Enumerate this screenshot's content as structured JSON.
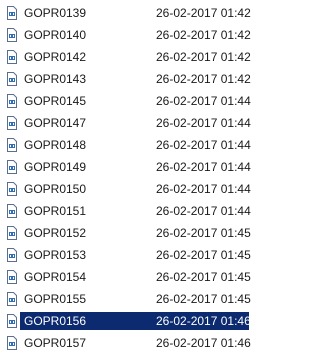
{
  "files": [
    {
      "name": "GOPR0139",
      "modified": "26-02-2017 01:42",
      "icon": "video-file-icon"
    },
    {
      "name": "GOPR0140",
      "modified": "26-02-2017 01:42",
      "icon": "video-file-icon"
    },
    {
      "name": "GOPR0142",
      "modified": "26-02-2017 01:42",
      "icon": "video-file-icon"
    },
    {
      "name": "GOPR0143",
      "modified": "26-02-2017 01:42",
      "icon": "video-file-icon"
    },
    {
      "name": "GOPR0145",
      "modified": "26-02-2017 01:44",
      "icon": "video-file-icon"
    },
    {
      "name": "GOPR0147",
      "modified": "26-02-2017 01:44",
      "icon": "video-file-icon"
    },
    {
      "name": "GOPR0148",
      "modified": "26-02-2017 01:44",
      "icon": "video-file-icon"
    },
    {
      "name": "GOPR0149",
      "modified": "26-02-2017 01:44",
      "icon": "video-file-icon"
    },
    {
      "name": "GOPR0150",
      "modified": "26-02-2017 01:44",
      "icon": "video-file-icon"
    },
    {
      "name": "GOPR0151",
      "modified": "26-02-2017 01:44",
      "icon": "video-file-icon"
    },
    {
      "name": "GOPR0152",
      "modified": "26-02-2017 01:45",
      "icon": "video-file-icon"
    },
    {
      "name": "GOPR0153",
      "modified": "26-02-2017 01:45",
      "icon": "video-file-icon"
    },
    {
      "name": "GOPR0154",
      "modified": "26-02-2017 01:45",
      "icon": "video-file-icon"
    },
    {
      "name": "GOPR0155",
      "modified": "26-02-2017 01:45",
      "icon": "video-file-icon"
    },
    {
      "name": "GOPR0156",
      "modified": "26-02-2017 01:46",
      "icon": "video-file-icon",
      "selected": true
    },
    {
      "name": "GOPR0157",
      "modified": "26-02-2017 01:46",
      "icon": "video-file-icon"
    }
  ],
  "colors": {
    "selection": "#0b2a6f",
    "text": "#1a1a1a",
    "selected_text": "#ffffff"
  }
}
